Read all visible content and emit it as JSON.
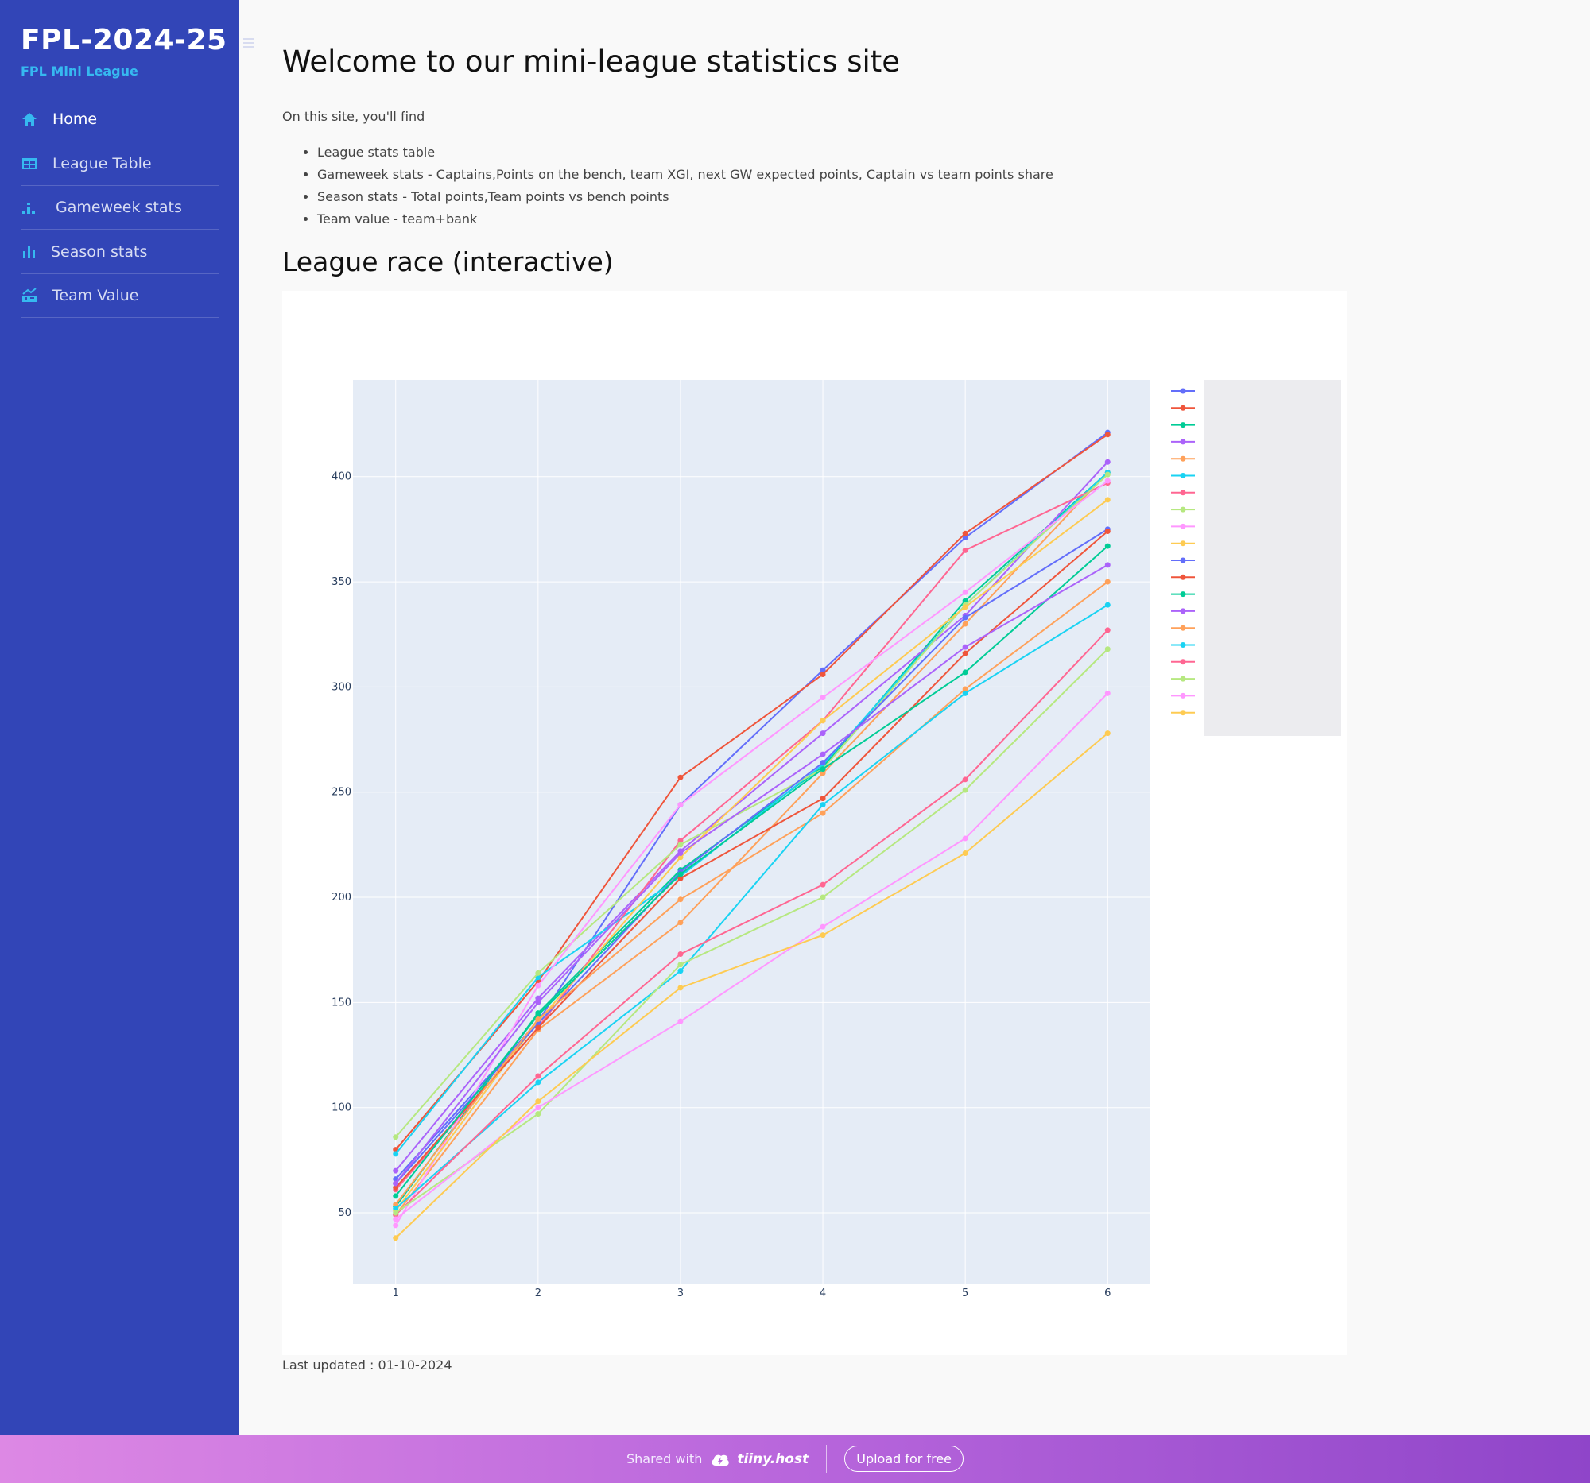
{
  "sidebar": {
    "brand_title": "FPL-2024-25",
    "brand_subtitle": "FPL Mini League",
    "items": [
      {
        "label": "Home",
        "icon": "home-icon",
        "active": true
      },
      {
        "label": "League Table",
        "icon": "table-icon",
        "active": false
      },
      {
        "label": "Gameweek stats",
        "icon": "chart-bar-icon",
        "active": false
      },
      {
        "label": "Season stats",
        "icon": "bar-chart-icon",
        "active": false
      },
      {
        "label": "Team Value",
        "icon": "money-chart-icon",
        "active": false
      }
    ]
  },
  "main": {
    "title": "Welcome to our mini-league statistics site",
    "intro": "On this site, you'll find",
    "features": [
      "League stats table",
      "Gameweek stats - Captains,Points on the bench, team XGI, next GW expected points, Captain vs team points share",
      "Season stats - Total points,Team points vs bench points",
      "Team value - team+bank"
    ],
    "chart_title": "League race (interactive)",
    "last_updated": "Last updated : 01-10-2024"
  },
  "footer": {
    "shared_with": "Shared with",
    "brand": "tiiny.host",
    "upload_label": "Upload for free"
  },
  "colors": {
    "sidebar_bg": "#3245b7",
    "accent": "#36b9f0",
    "plot_bg": "#e5ecf6"
  },
  "chart_data": {
    "type": "line",
    "title": "",
    "xlabel": "",
    "ylabel": "",
    "x": [
      1,
      2,
      3,
      4,
      5,
      6
    ],
    "xlim": [
      0.7,
      6.3
    ],
    "ylim": [
      16,
      446
    ],
    "yticks": [
      50,
      100,
      150,
      200,
      250,
      300,
      350,
      400
    ],
    "grid": true,
    "legend_position": "right",
    "series": [
      {
        "color": "#636efa",
        "values": [
          66,
          141,
          244,
          308,
          371,
          421
        ]
      },
      {
        "color": "#ef553b",
        "values": [
          80,
          160,
          257,
          306,
          373,
          420
        ]
      },
      {
        "color": "#00cc96",
        "values": [
          53,
          145,
          213,
          262,
          341,
          402
        ]
      },
      {
        "color": "#ab63fa",
        "values": [
          70,
          152,
          222,
          278,
          334,
          407
        ]
      },
      {
        "color": "#ffa15a",
        "values": [
          49,
          137,
          188,
          259,
          330,
          402
        ]
      },
      {
        "color": "#19d3f3",
        "values": [
          78,
          162,
          210,
          263,
          339,
          402
        ]
      },
      {
        "color": "#ff6692",
        "values": [
          61,
          138,
          227,
          284,
          365,
          397
        ]
      },
      {
        "color": "#b6e880",
        "values": [
          86,
          164,
          225,
          261,
          339,
          401
        ]
      },
      {
        "color": "#ff97ff",
        "values": [
          44,
          158,
          244,
          295,
          345,
          398
        ]
      },
      {
        "color": "#fecb52",
        "values": [
          51,
          141,
          219,
          284,
          338,
          389
        ]
      },
      {
        "color": "#636efa",
        "values": [
          64,
          140,
          212,
          264,
          333,
          375
        ]
      },
      {
        "color": "#ef553b",
        "values": [
          62,
          138,
          209,
          247,
          316,
          374
        ]
      },
      {
        "color": "#00cc96",
        "values": [
          58,
          144,
          211,
          261,
          307,
          367
        ]
      },
      {
        "color": "#ab63fa",
        "values": [
          64,
          150,
          221,
          268,
          319,
          358
        ]
      },
      {
        "color": "#ffa15a",
        "values": [
          54,
          142,
          199,
          240,
          299,
          350
        ]
      },
      {
        "color": "#19d3f3",
        "values": [
          52,
          112,
          165,
          244,
          297,
          339
        ]
      },
      {
        "color": "#ff6692",
        "values": [
          49,
          115,
          173,
          206,
          256,
          327
        ]
      },
      {
        "color": "#b6e880",
        "values": [
          50,
          97,
          168,
          200,
          251,
          318
        ]
      },
      {
        "color": "#ff97ff",
        "values": [
          47,
          100,
          141,
          186,
          228,
          297
        ]
      },
      {
        "color": "#fecb52",
        "values": [
          38,
          103,
          157,
          182,
          221,
          278
        ]
      }
    ]
  }
}
